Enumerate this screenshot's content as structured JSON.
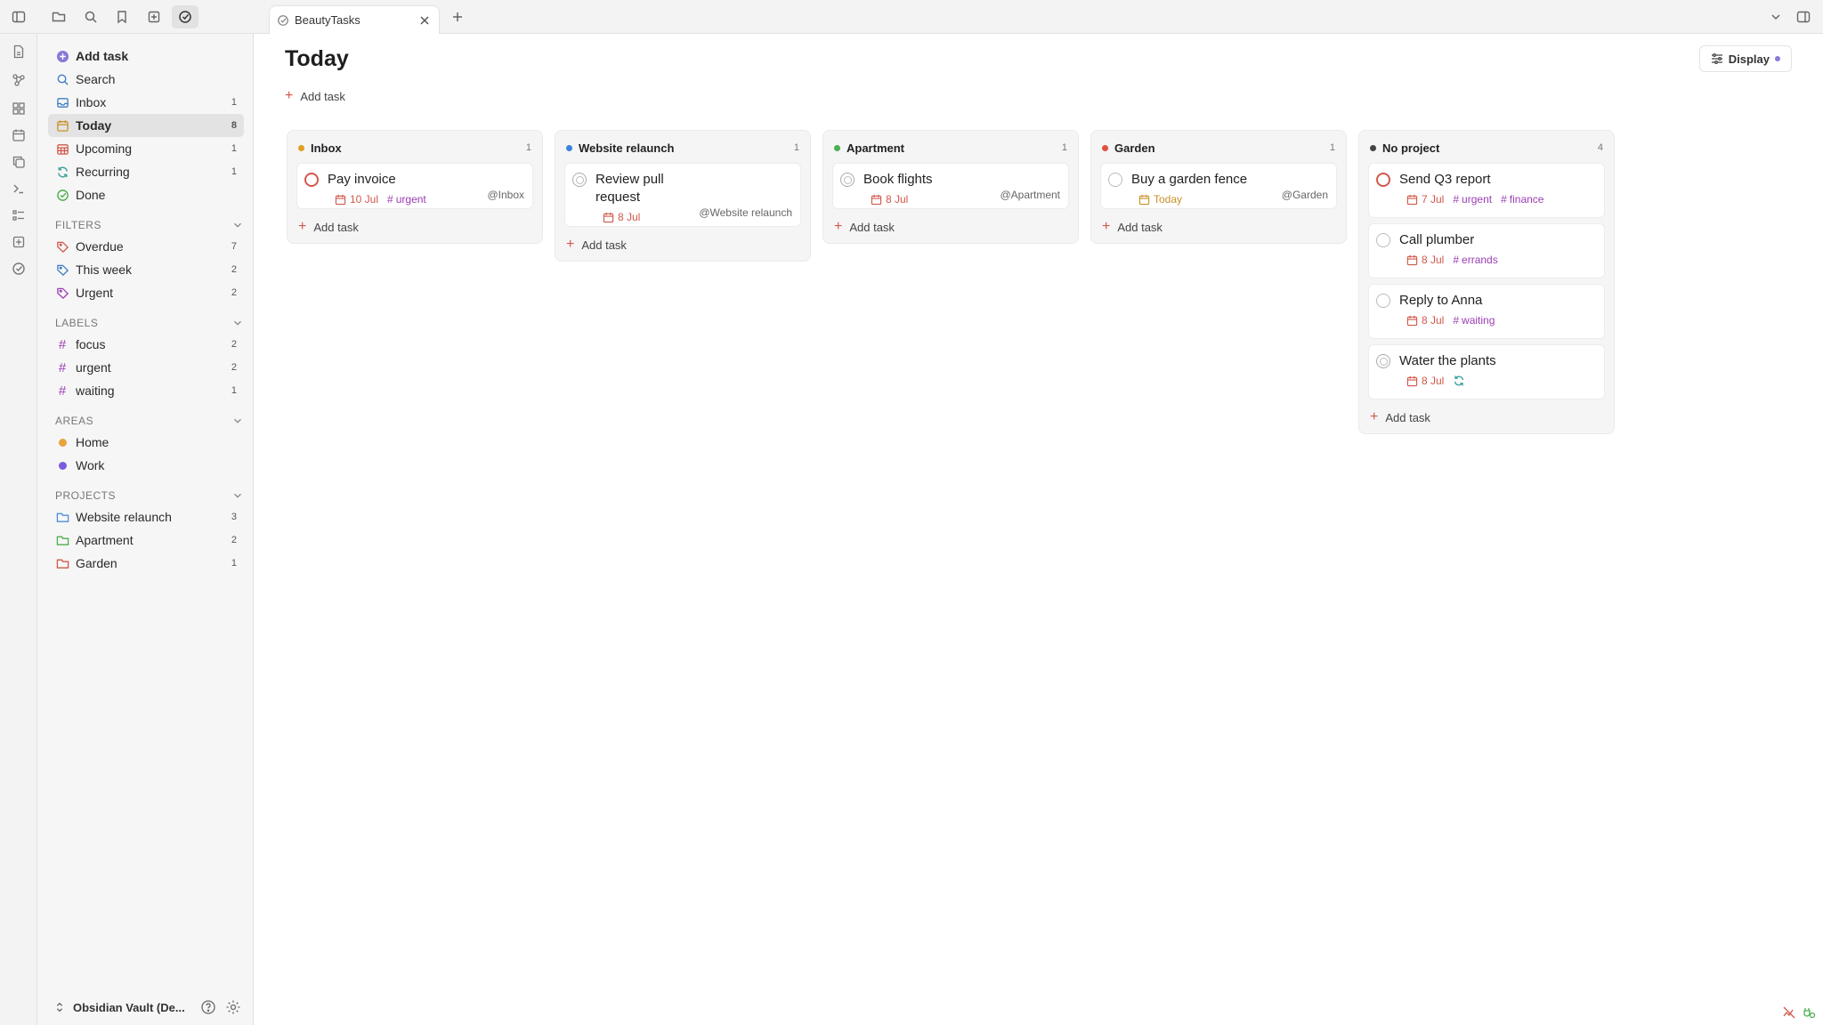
{
  "tab": {
    "label": "BeautyTasks"
  },
  "sidebar": {
    "add_task": "Add task",
    "nav": [
      {
        "label": "Search",
        "count": ""
      },
      {
        "label": "Inbox",
        "count": "1"
      },
      {
        "label": "Today",
        "count": "8"
      },
      {
        "label": "Upcoming",
        "count": "1"
      },
      {
        "label": "Recurring",
        "count": "1"
      },
      {
        "label": "Done",
        "count": ""
      }
    ],
    "filters_title": "FILTERS",
    "filters": [
      {
        "label": "Overdue",
        "count": "7"
      },
      {
        "label": "This week",
        "count": "2"
      },
      {
        "label": "Urgent",
        "count": "2"
      }
    ],
    "labels_title": "LABELS",
    "labels": [
      {
        "label": "focus",
        "count": "2"
      },
      {
        "label": "urgent",
        "count": "2"
      },
      {
        "label": "waiting",
        "count": "1"
      }
    ],
    "areas_title": "AREAS",
    "areas": [
      {
        "label": "Home",
        "color": "#e8a33d"
      },
      {
        "label": "Work",
        "color": "#7b5ce0"
      }
    ],
    "projects_title": "PROJECTS",
    "projects": [
      {
        "label": "Website relaunch",
        "count": "3",
        "color": "#4a8fd9"
      },
      {
        "label": "Apartment",
        "count": "2",
        "color": "#4caf50"
      },
      {
        "label": "Garden",
        "count": "1",
        "color": "#d0584a"
      }
    ],
    "vault": "Obsidian Vault (De..."
  },
  "main": {
    "title": "Today",
    "add_task": "Add task",
    "display": "Display",
    "columns": [
      {
        "name": "Inbox",
        "count": "1",
        "color": "#e0a020",
        "tasks": [
          {
            "title": "Pay invoice",
            "date": "10 Jul",
            "tags": [
              "urgent"
            ],
            "context": "@Inbox"
          }
        ],
        "add": "Add task"
      },
      {
        "name": "Website relaunch",
        "count": "1",
        "color": "#3b82e0",
        "tasks": [
          {
            "title_line1": "Review pull",
            "title_line2": "request",
            "date": "8 Jul",
            "context": "@Website relaunch"
          }
        ],
        "add": "Add task"
      },
      {
        "name": "Apartment",
        "count": "1",
        "color": "#4caf50",
        "tasks": [
          {
            "title": "Book flights",
            "date": "8 Jul",
            "context": "@Apartment"
          }
        ],
        "add": "Add task"
      },
      {
        "name": "Garden",
        "count": "1",
        "color": "#e0513f",
        "tasks": [
          {
            "title": "Buy a garden fence",
            "date": "Today",
            "context": "@Garden"
          }
        ],
        "add": "Add task"
      },
      {
        "name": "No project",
        "count": "4",
        "color": "#444444",
        "tasks": [
          {
            "title": "Send Q3 report",
            "date": "7 Jul",
            "tags": [
              "urgent",
              "finance"
            ]
          },
          {
            "title": "Call plumber",
            "date": "8 Jul",
            "tags": [
              "errands"
            ]
          },
          {
            "title": "Reply to Anna",
            "date": "8 Jul",
            "tags": [
              "waiting"
            ]
          },
          {
            "title": "Water the plants",
            "date": "8 Jul"
          }
        ],
        "add": "Add task"
      }
    ]
  }
}
